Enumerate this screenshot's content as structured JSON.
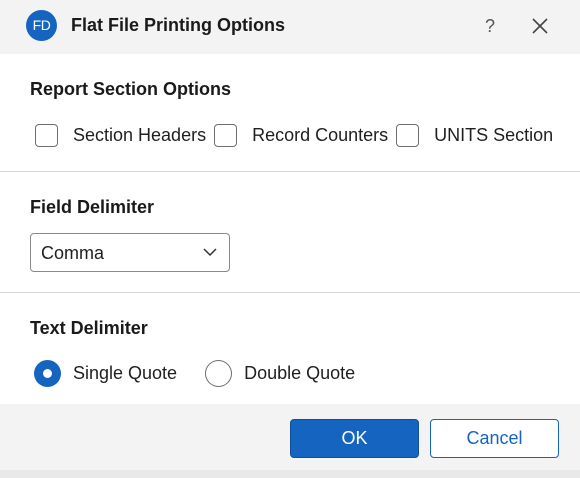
{
  "window": {
    "app_icon_text": "FD",
    "title": "Flat File Printing Options",
    "help_label": "?",
    "close_icon": "close-icon"
  },
  "report_section": {
    "heading": "Report Section Options",
    "checkboxes": [
      {
        "label": "Section Headers",
        "checked": false
      },
      {
        "label": "Record Counters",
        "checked": false
      },
      {
        "label": "UNITS Section",
        "checked": false
      }
    ]
  },
  "field_delimiter": {
    "heading": "Field Delimiter",
    "selected": "Comma"
  },
  "text_delimiter": {
    "heading": "Text Delimiter",
    "options": [
      {
        "label": "Single Quote",
        "selected": true
      },
      {
        "label": "Double Quote",
        "selected": false
      }
    ]
  },
  "footer": {
    "ok_label": "OK",
    "cancel_label": "Cancel"
  },
  "colors": {
    "accent": "#1565c0",
    "titlebar_bg": "#f3f3f3",
    "divider": "#d6d6d6"
  }
}
